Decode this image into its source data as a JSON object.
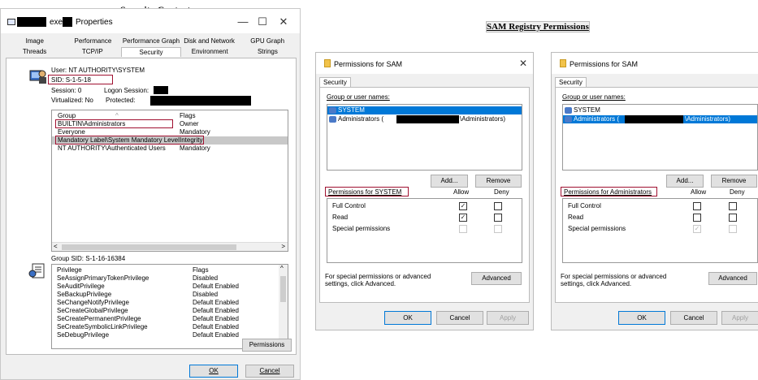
{
  "headers": {
    "security_context": "Security Context",
    "sam_registry": "SAM Registry Permissions"
  },
  "props": {
    "title_exe": "exe",
    "title_suffix": "Properties",
    "tabs_row1": [
      "Image",
      "Performance",
      "Performance Graph",
      "Disk and Network",
      "GPU Graph"
    ],
    "tabs_row2": [
      "Threads",
      "TCP/IP",
      "Security",
      "Environment",
      "Strings"
    ],
    "user": "User:    NT AUTHORITY\\SYSTEM",
    "sid": "SID:      S-1-5-18",
    "session": "Session:  0",
    "logon_session": "Logon Session:",
    "virtualized": "Virtualized: No",
    "protected": "Protected:",
    "group_header": "Group",
    "flags_header": "Flags",
    "groups": [
      {
        "group": "BUILTIN\\Administrators",
        "flags": "Owner"
      },
      {
        "group": "Everyone",
        "flags": "Mandatory"
      },
      {
        "group": "Mandatory Label\\System Mandatory Level",
        "flags": "Integrity"
      },
      {
        "group": "NT AUTHORITY\\Authenticated Users",
        "flags": "Mandatory"
      }
    ],
    "group_sid": "Group SID:  S-1-16-16384",
    "privilege_header": "Privilege",
    "privileges": [
      {
        "name": "SeAssignPrimaryTokenPrivilege",
        "flags": "Disabled"
      },
      {
        "name": "SeAuditPrivilege",
        "flags": "Default Enabled"
      },
      {
        "name": "SeBackupPrivilege",
        "flags": "Disabled"
      },
      {
        "name": "SeChangeNotifyPrivilege",
        "flags": "Default Enabled"
      },
      {
        "name": "SeCreateGlobalPrivilege",
        "flags": "Default Enabled"
      },
      {
        "name": "SeCreatePermanentPrivilege",
        "flags": "Default Enabled"
      },
      {
        "name": "SeCreateSymbolicLinkPrivilege",
        "flags": "Default Enabled"
      },
      {
        "name": "SeDebugPrivilege",
        "flags": "Default Enabled"
      }
    ],
    "permissions_btn": "Permissions",
    "ok_btn": "OK",
    "cancel_btn": "Cancel"
  },
  "sam": [
    {
      "title": "Permissions for SAM",
      "tab": "Security",
      "group_label": "Group or user names:",
      "users": [
        {
          "name": "SYSTEM",
          "suffix": "",
          "selected": true
        },
        {
          "name": "Administrators (",
          "suffix": "\\Administrators)",
          "selected": false
        }
      ],
      "add_btn": "Add...",
      "remove_btn": "Remove",
      "perm_label": "Permissions for SYSTEM",
      "allow": "Allow",
      "deny": "Deny",
      "perms": [
        {
          "name": "Full Control",
          "allow": "✓",
          "deny": "",
          "disabled": false
        },
        {
          "name": "Read",
          "allow": "✓",
          "deny": "",
          "disabled": false
        },
        {
          "name": "Special permissions",
          "allow": "",
          "deny": "",
          "disabled": true
        }
      ],
      "adv_text": "For special permissions or advanced settings, click Advanced.",
      "advanced_btn": "Advanced",
      "ok": "OK",
      "cancel": "Cancel",
      "apply": "Apply"
    },
    {
      "title": "Permissions for SAM",
      "tab": "Security",
      "group_label": "Group or user names:",
      "users": [
        {
          "name": "SYSTEM",
          "suffix": "",
          "selected": false
        },
        {
          "name": "Administrators (",
          "suffix": "\\Administrators)",
          "selected": true
        }
      ],
      "add_btn": "Add...",
      "remove_btn": "Remove",
      "perm_label": "Permissions for Administrators",
      "allow": "Allow",
      "deny": "Deny",
      "perms": [
        {
          "name": "Full Control",
          "allow": "",
          "deny": "",
          "disabled": false
        },
        {
          "name": "Read",
          "allow": "",
          "deny": "",
          "disabled": false
        },
        {
          "name": "Special permissions",
          "allow": "✓",
          "deny": "",
          "disabled": true
        }
      ],
      "adv_text": "For special permissions or advanced settings, click Advanced.",
      "advanced_btn": "Advanced",
      "ok": "OK",
      "cancel": "Cancel",
      "apply": "Apply"
    }
  ]
}
